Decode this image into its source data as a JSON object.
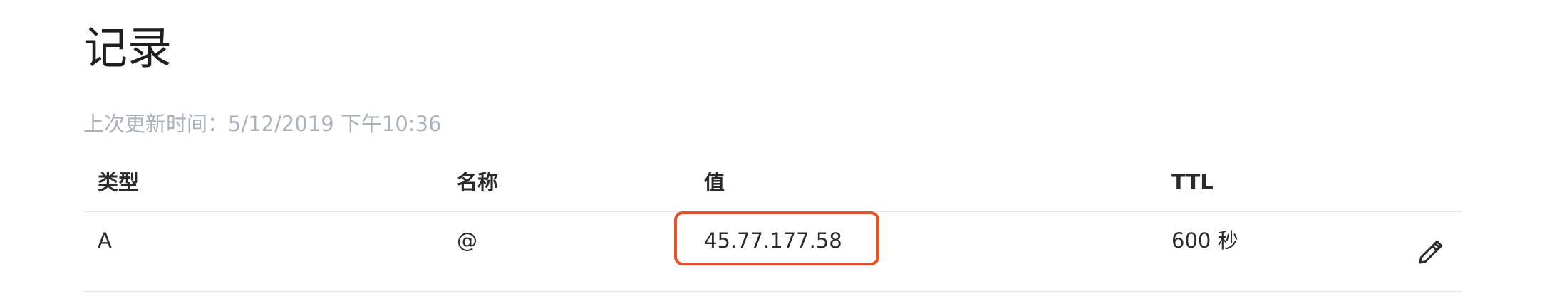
{
  "page": {
    "title": "记录",
    "last_updated": "上次更新时间：5/12/2019 下午10:36"
  },
  "table": {
    "columns": {
      "type": "类型",
      "name": "名称",
      "value": "值",
      "ttl": "TTL"
    },
    "rows": [
      {
        "type": "A",
        "name": "@",
        "value": "45.77.177.58",
        "ttl": "600 秒",
        "action_icon": "pencil-icon"
      }
    ]
  },
  "colors": {
    "highlight_border": "#e8502a",
    "muted_text": "#a9b1bb",
    "divider": "#e3e6ea"
  }
}
